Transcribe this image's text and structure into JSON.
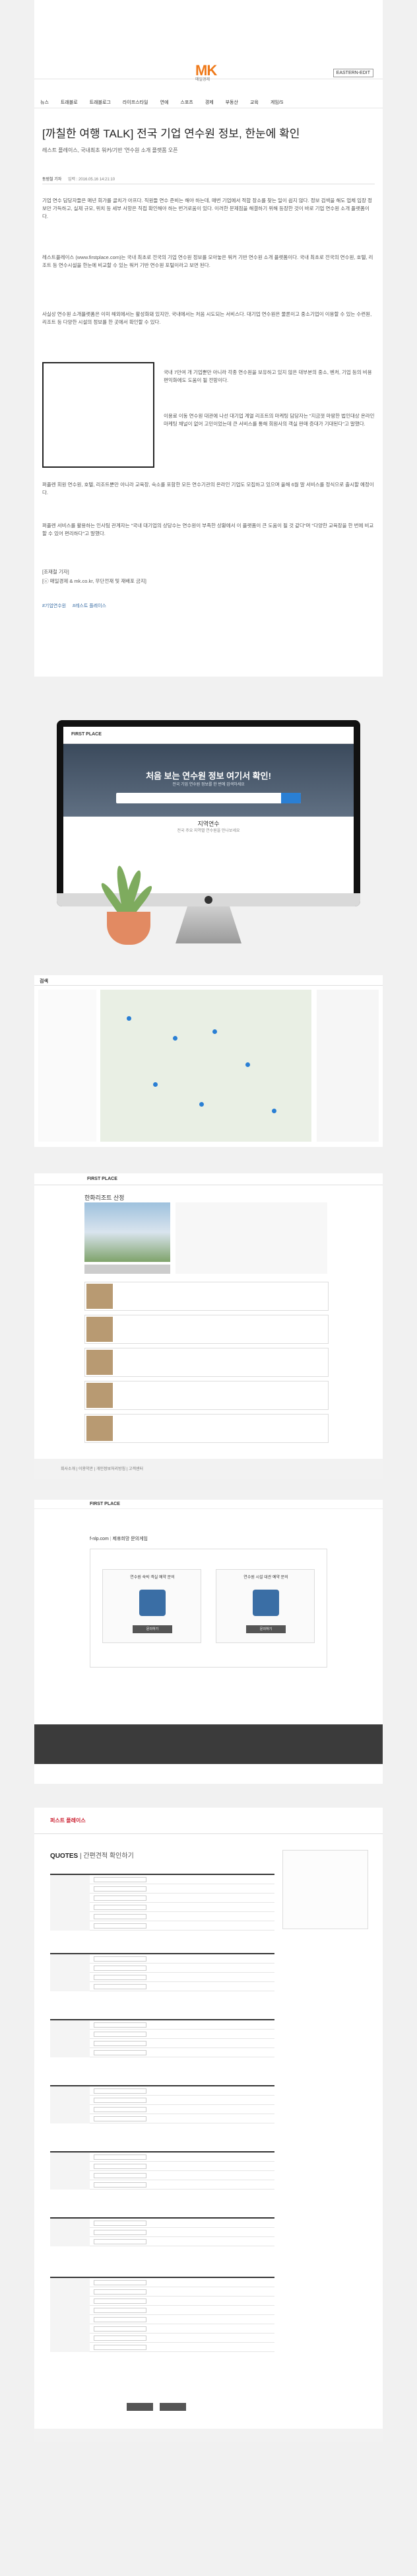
{
  "article": {
    "logo_text": "MK",
    "logo_tag": "매일경제",
    "edition_label": "EASTERN-EDIT",
    "nav": [
      "뉴스",
      "트래블로",
      "트래블로그",
      "라이프스타일",
      "연예",
      "스포츠",
      "경제",
      "부동산",
      "교육",
      "게임/S"
    ],
    "headline": "[까칠한 여행 TALK] 전국 기업 연수원 정보, 한눈에 확인",
    "subhead": "레스트 플레이스, 국내최초 워커/기반 '연수원 소개 플랫폼 오픈",
    "byline_label": "동범철 기자",
    "byline_meta": "입력 : 2016.05.16 14:21:10",
    "paragraphs": [
      "기업 연수 담당자들은 매년 회가를 골치가 아프다. 직원들 연수 준비는 해야 하는데, 매번 기업에서 적합 장소를 찾는 일이 쉽지 않다. 정보 검색을 해도 업체 입장 정보만 가득하고, 실제 규모, 위치 등 세부 사항은 직접 확인해야 하는 번거로움이 있다. 이러한 문제점을 해결하기 위해 등장한 것이 바로 기업 연수원 소개 플랫폼이다.",
      "레스트플레이스 (www.firstplace.com)는 국내 최초로 전국의 기업 연수원 정보를 모아놓은 워커 기반 연수원 소개 플랫폼이다. 국내 최초로 전국의 연수원, 호텔, 리조트 등 연수시설을 한눈에 비교할 수 있는 워커 기반 연수원 포털이라고 보면 된다.",
      "사실상 연수원 소개플랫폼은 이미 해외에서는 활성화돼 있지만, 국내에서는 처음 시도되는 서비스다. 대기업 연수원은 물론이고 중소기업이 이용할 수 있는 수련원, 리조트 등 다양한 시설의 정보를 한 곳에서 확인할 수 있다."
    ],
    "side_paragraphs": [
      "국내 7만여 개 기업뿐만 아니라 각종 연수원을 보유하고 있지 않은 대부분의 중소, 벤처, 기업 등의 비용편익화에도 도움이 될 전망이다.",
      "이용료 이동 연수원 대관에 나선 대기업 계열 리조트의 마케팅 담당자는 \"지금껏 마땅한 법인대상 온라인 마케팅 채널이 없어 고민이었는데 큰 서비스를 통해 회원사의 객실 판매 증대가 기대된다\"고 말했다."
    ],
    "closing_paragraphs": [
      "퍼플렌 회원 연수원, 호텔, 리조트뿐만 아니라 교육장, 숙소를 포함한 모든 연수기관의 온라인 기업도 모집하고 있으며 올해 6월 말 서비스를 정식으로 출시할 예정이다.",
      "퍼플렌 서비스를 활용하는 인사팀 관계자는 \"국내 대기업의 상당수는 연수원이 부족한 상황에서 이 플랫폼이 큰 도움이 될 것 같다\"며 \"다양한 교육장을 한 번에 비교할 수 있어 편리하다\"고 말했다.",
      "[조재철 기자]",
      "[ⓒ 매일경제 & mk.co.kr, 무단전재 및 재배포 금지]"
    ],
    "tags": [
      "#기업연수원",
      "#레스트 플레이스"
    ]
  },
  "imac": {
    "logo": "FIRST PLACE",
    "hero_title": "처음 보는 연수원 정보 여기서 확인!",
    "hero_sub": "전국 기업 연수원 정보를 한 번에 검색하세요",
    "section_title": "지역연수",
    "section_sub": "전국 주요 지역별 연수원을 만나보세요"
  },
  "map": {
    "title": "검색"
  },
  "detail": {
    "brand": "FIRST PLACE",
    "title": "한화리조트 산정",
    "footer": "회사소개 | 이용약관 | 개인정보처리방침 | 고객센터"
  },
  "request": {
    "brand": "FIRST PLACE",
    "brand_site": "f-nlp.com",
    "brand_label": "제휴희망 문의게임",
    "box1_caption": "연수원 숙박 객실 예약 문의",
    "box2_caption": "연수원 시설 대관 예약 문의",
    "box_button": "문의하기"
  },
  "quotes": {
    "brand": "퍼스트 플레이스",
    "title_en": "QUOTES",
    "title_ko": "간편견적 확인하기"
  }
}
